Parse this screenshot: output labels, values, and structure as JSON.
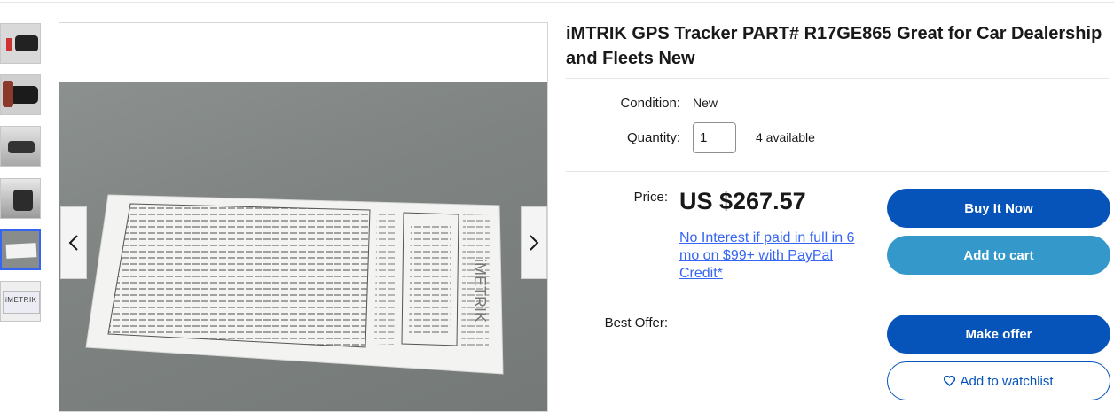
{
  "listing": {
    "title": "iMTRIK GPS Tracker PART# R17GE865 Great for Car Dealership and Fleets New",
    "condition_label": "Condition:",
    "condition_value": "New",
    "quantity_label": "Quantity:",
    "quantity_value": "1",
    "available_text": "4 available",
    "price_label": "Price:",
    "price_value": "US $267.57",
    "paypal_text": "No Interest if paid in full in 6 mo on $99+ with PayPal Credit*",
    "best_offer_label": "Best Offer:"
  },
  "buttons": {
    "buy_now": "Buy It Now",
    "add_to_cart": "Add to cart",
    "make_offer": "Make offer",
    "watchlist": "Add to watchlist"
  },
  "gallery": {
    "thumbnails": [
      {
        "icon": "device-with-cable-thumbnail"
      },
      {
        "icon": "device-closeup-thumbnail"
      },
      {
        "icon": "device-in-hand-thumbnail"
      },
      {
        "icon": "device-side-thumbnail"
      },
      {
        "icon": "instruction-sheet-thumbnail",
        "selected": true
      },
      {
        "icon": "product-box-thumbnail"
      }
    ],
    "photo_brand_text": "iMETRIK",
    "box_brand_text": "iMETRIK",
    "prev_icon": "chevron-left-icon",
    "next_icon": "chevron-right-icon"
  },
  "colors": {
    "primary_blue": "#0654ba",
    "secondary_blue": "#3498ca",
    "link_blue": "#3665f3",
    "selected_thumb_border": "#3665f3"
  }
}
